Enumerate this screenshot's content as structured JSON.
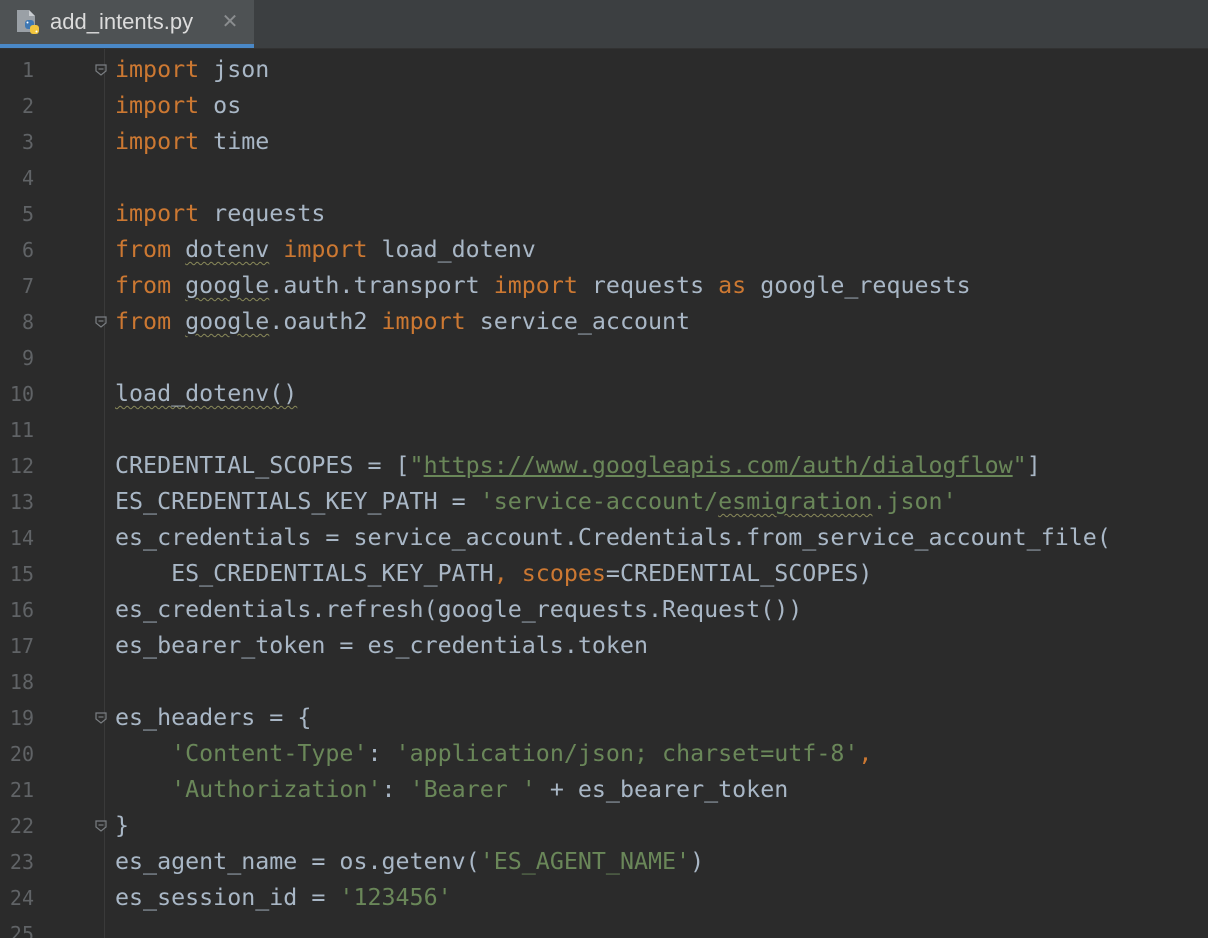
{
  "tab": {
    "filename": "add_intents.py",
    "close_glyph": "✕",
    "icon": "python-file-icon"
  },
  "colors": {
    "keyword": "#cc7832",
    "string": "#6a8759",
    "identifier": "#a9b7c6",
    "line_number": "#606366",
    "background": "#2b2b2b",
    "tab_accent": "#4a88c7"
  },
  "lines": [
    {
      "n": "1",
      "fold": true,
      "tokens": [
        {
          "t": "import",
          "c": "kw"
        },
        {
          "t": " json"
        }
      ]
    },
    {
      "n": "2",
      "tokens": [
        {
          "t": "import",
          "c": "kw"
        },
        {
          "t": " os"
        }
      ]
    },
    {
      "n": "3",
      "tokens": [
        {
          "t": "import",
          "c": "kw"
        },
        {
          "t": " time"
        }
      ]
    },
    {
      "n": "4",
      "tokens": []
    },
    {
      "n": "5",
      "tokens": [
        {
          "t": "import",
          "c": "kw"
        },
        {
          "t": " requests"
        }
      ]
    },
    {
      "n": "6",
      "tokens": [
        {
          "t": "from",
          "c": "kw"
        },
        {
          "t": " "
        },
        {
          "t": "dotenv",
          "c": "squig"
        },
        {
          "t": " "
        },
        {
          "t": "import",
          "c": "kw"
        },
        {
          "t": " load_dotenv"
        }
      ]
    },
    {
      "n": "7",
      "tokens": [
        {
          "t": "from",
          "c": "kw"
        },
        {
          "t": " "
        },
        {
          "t": "google",
          "c": "squig"
        },
        {
          "t": ".auth.transport "
        },
        {
          "t": "import",
          "c": "kw"
        },
        {
          "t": " requests "
        },
        {
          "t": "as",
          "c": "kw"
        },
        {
          "t": " google_requests"
        }
      ]
    },
    {
      "n": "8",
      "fold": true,
      "tokens": [
        {
          "t": "from",
          "c": "kw"
        },
        {
          "t": " "
        },
        {
          "t": "google",
          "c": "squig"
        },
        {
          "t": ".oauth2 "
        },
        {
          "t": "import",
          "c": "kw"
        },
        {
          "t": " service_account"
        }
      ]
    },
    {
      "n": "9",
      "tokens": []
    },
    {
      "n": "10",
      "tokens": [
        {
          "t": "load_dotenv()",
          "c": "squig"
        }
      ]
    },
    {
      "n": "11",
      "tokens": []
    },
    {
      "n": "12",
      "tokens": [
        {
          "t": "CREDENTIAL_SCOPES = ["
        },
        {
          "t": "\"",
          "c": "str"
        },
        {
          "t": "https://www.googleapis.com/auth/dialogflow",
          "c": "url"
        },
        {
          "t": "\"",
          "c": "str"
        },
        {
          "t": "]"
        }
      ]
    },
    {
      "n": "13",
      "tokens": [
        {
          "t": "ES_CREDENTIALS_KEY_PATH = "
        },
        {
          "t": "'service-account/",
          "c": "str"
        },
        {
          "t": "esmigration",
          "c": "str squig"
        },
        {
          "t": ".json'",
          "c": "str"
        }
      ]
    },
    {
      "n": "14",
      "tokens": [
        {
          "t": "es_credentials = service_account.Credentials.from_service_account_file("
        }
      ]
    },
    {
      "n": "15",
      "tokens": [
        {
          "t": "    ES_CREDENTIALS_KEY_PATH"
        },
        {
          "t": ",",
          "c": "kw"
        },
        {
          "t": " "
        },
        {
          "t": "scopes",
          "c": "param"
        },
        {
          "t": "=CREDENTIAL_SCOPES)"
        }
      ]
    },
    {
      "n": "16",
      "tokens": [
        {
          "t": "es_credentials.refresh(google_requests.Request())"
        }
      ]
    },
    {
      "n": "17",
      "tokens": [
        {
          "t": "es_bearer_token = es_credentials.token"
        }
      ]
    },
    {
      "n": "18",
      "tokens": []
    },
    {
      "n": "19",
      "fold": true,
      "tokens": [
        {
          "t": "es_headers = {"
        }
      ]
    },
    {
      "n": "20",
      "tokens": [
        {
          "t": "    "
        },
        {
          "t": "'Content-Type'",
          "c": "str"
        },
        {
          "t": ": "
        },
        {
          "t": "'application/json; charset=utf-8'",
          "c": "str"
        },
        {
          "t": ",",
          "c": "kw"
        }
      ]
    },
    {
      "n": "21",
      "tokens": [
        {
          "t": "    "
        },
        {
          "t": "'Authorization'",
          "c": "str"
        },
        {
          "t": ": "
        },
        {
          "t": "'Bearer '",
          "c": "str"
        },
        {
          "t": " + es_bearer_token"
        }
      ]
    },
    {
      "n": "22",
      "fold": true,
      "tokens": [
        {
          "t": "}"
        }
      ]
    },
    {
      "n": "23",
      "tokens": [
        {
          "t": "es_agent_name = os.getenv("
        },
        {
          "t": "'ES_AGENT_NAME'",
          "c": "str"
        },
        {
          "t": ")"
        }
      ]
    },
    {
      "n": "24",
      "tokens": [
        {
          "t": "es_session_id = "
        },
        {
          "t": "'123456'",
          "c": "str"
        }
      ]
    },
    {
      "n": "25",
      "tokens": []
    }
  ]
}
